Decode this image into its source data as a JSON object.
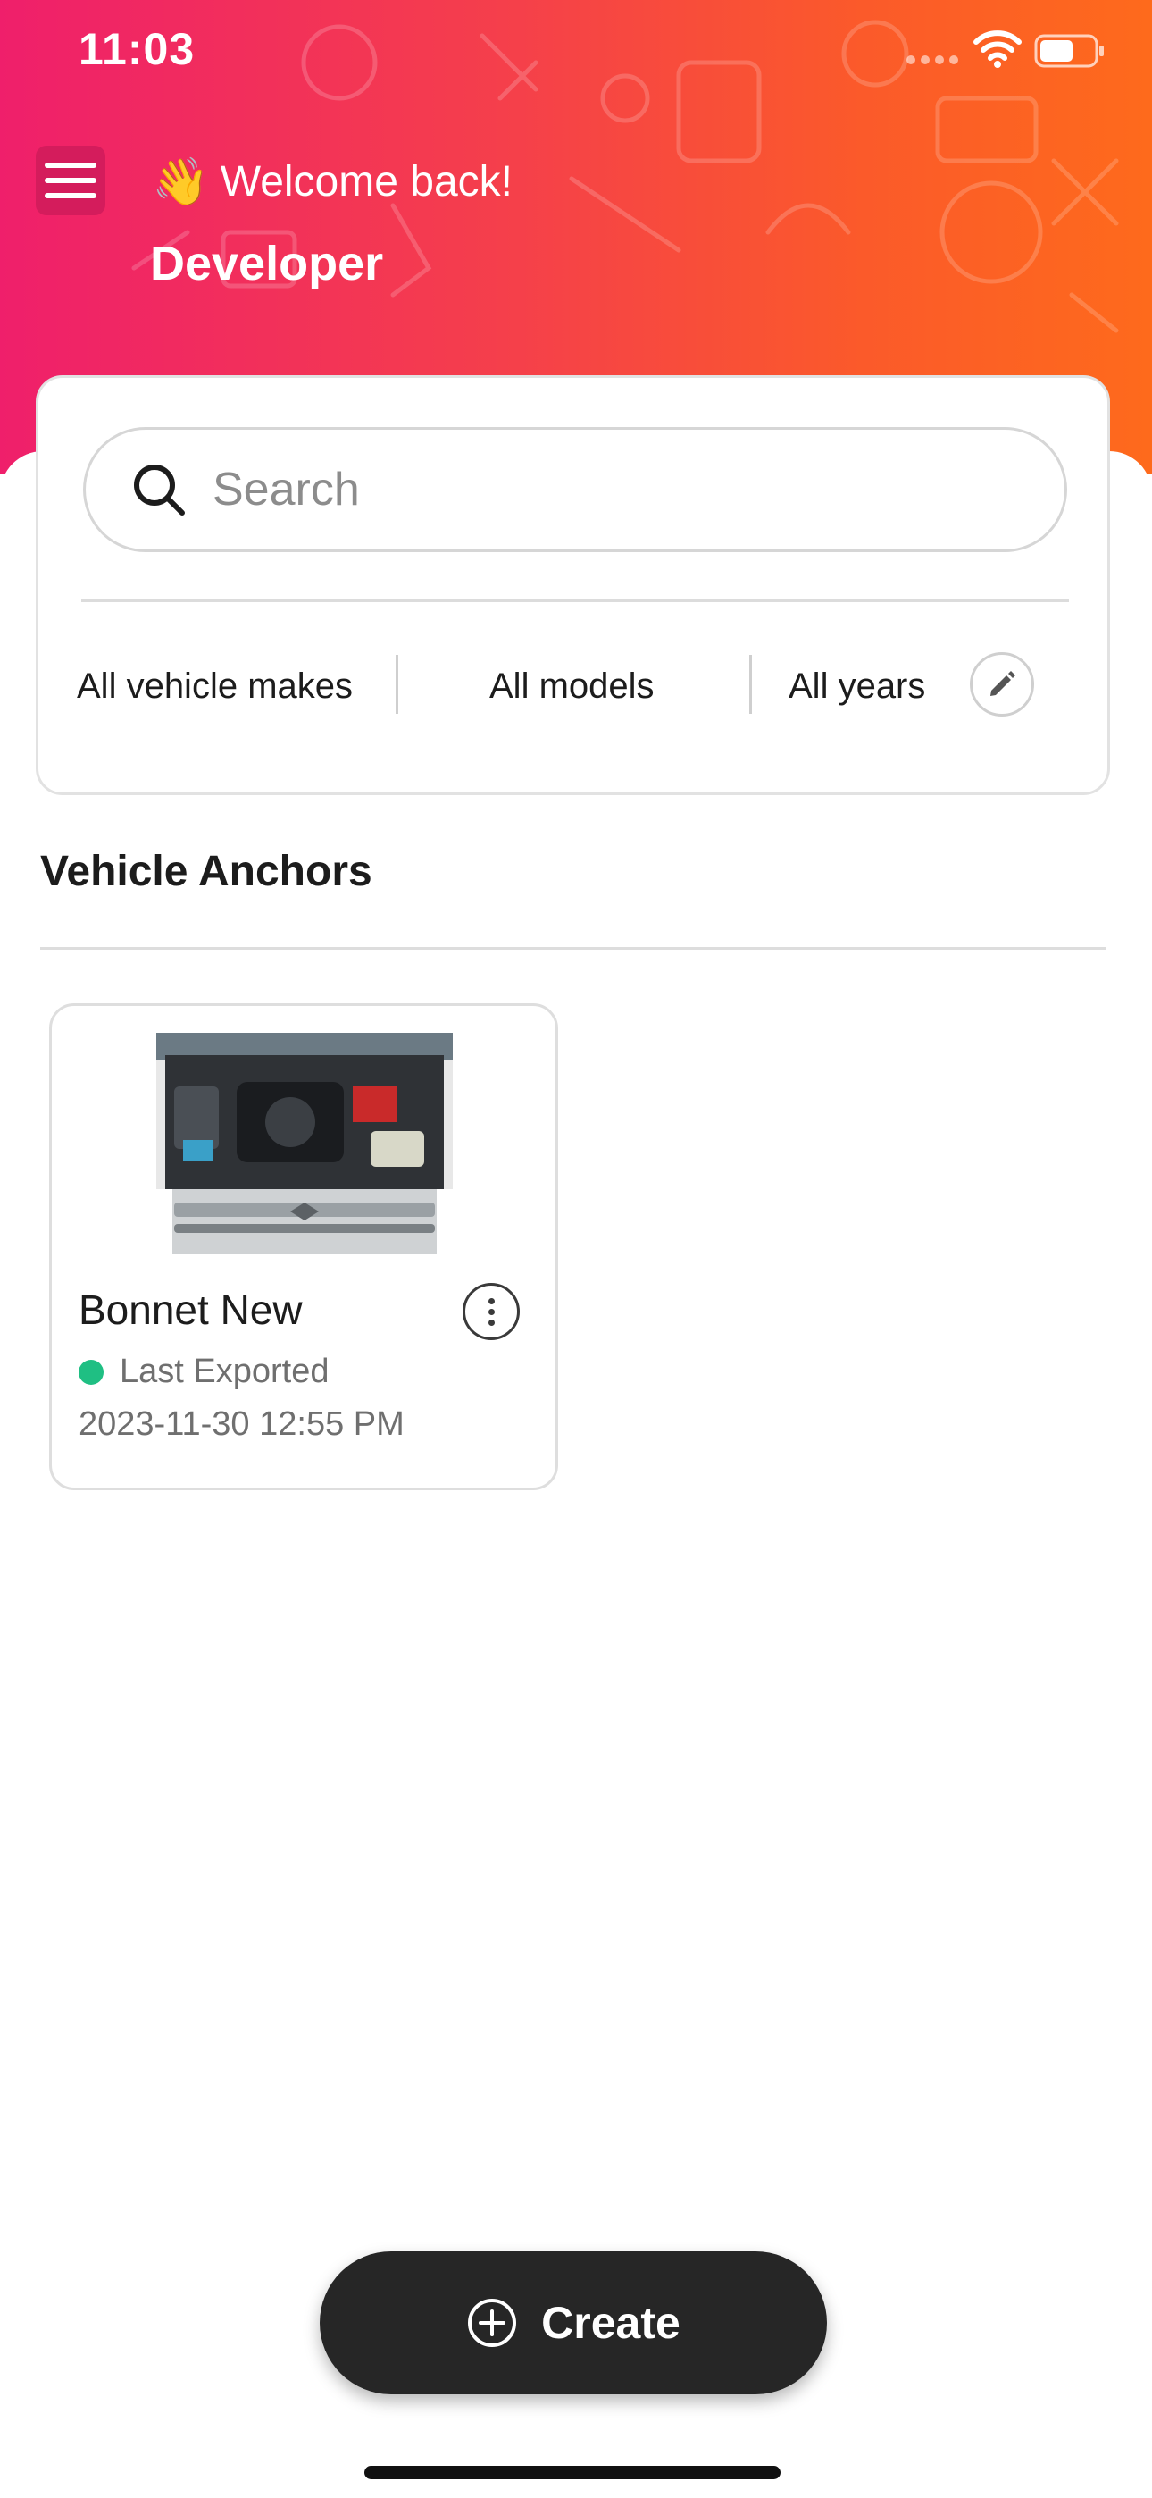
{
  "status_bar": {
    "time": "11:03"
  },
  "header": {
    "wave_emoji": "👋",
    "welcome": "Welcome back!",
    "user_name": "Developer",
    "gradient_colors": [
      "#ef1f6b",
      "#fe6a1c"
    ]
  },
  "search": {
    "placeholder": "Search",
    "value": ""
  },
  "filters": {
    "makes": "All vehicle makes",
    "models": "All models",
    "years": "All years"
  },
  "section": {
    "title": "Vehicle Anchors"
  },
  "anchors": [
    {
      "name": "Bonnet New",
      "status": "Last Exported",
      "status_color": "#1fbf83",
      "date": "2023-11-30 12:55 PM"
    }
  ],
  "create_button": {
    "label": "Create"
  },
  "icons": {
    "menu": "hamburger-menu-icon",
    "search": "search-icon",
    "edit": "pencil-icon",
    "more": "more-vertical-icon",
    "create": "plus-circle-icon"
  }
}
